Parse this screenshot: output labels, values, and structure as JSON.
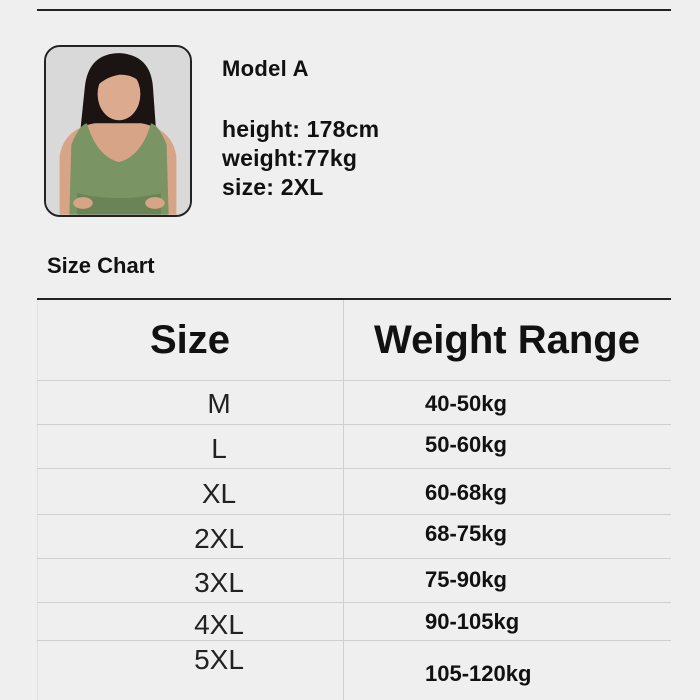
{
  "model": {
    "name": "Model A",
    "height": "height: 178cm",
    "weight": "weight:77kg",
    "size": "size: 2XL"
  },
  "size_chart": {
    "title": "Size Chart",
    "headers": {
      "size": "Size",
      "weight_range": "Weight Range"
    },
    "rows": [
      {
        "size": "M",
        "weight": "40-50kg"
      },
      {
        "size": "L",
        "weight": "50-60kg"
      },
      {
        "size": "XL",
        "weight": "60-68kg"
      },
      {
        "size": "2XL",
        "weight": "68-75kg"
      },
      {
        "size": "3XL",
        "weight": "75-90kg"
      },
      {
        "size": "4XL",
        "weight": "90-105kg"
      },
      {
        "size": "5XL",
        "weight": "105-120kg"
      }
    ]
  },
  "colors": {
    "background": "#efefef",
    "garment": "#7a9463",
    "rule": "#222222",
    "grid": "#cfcfcf"
  }
}
